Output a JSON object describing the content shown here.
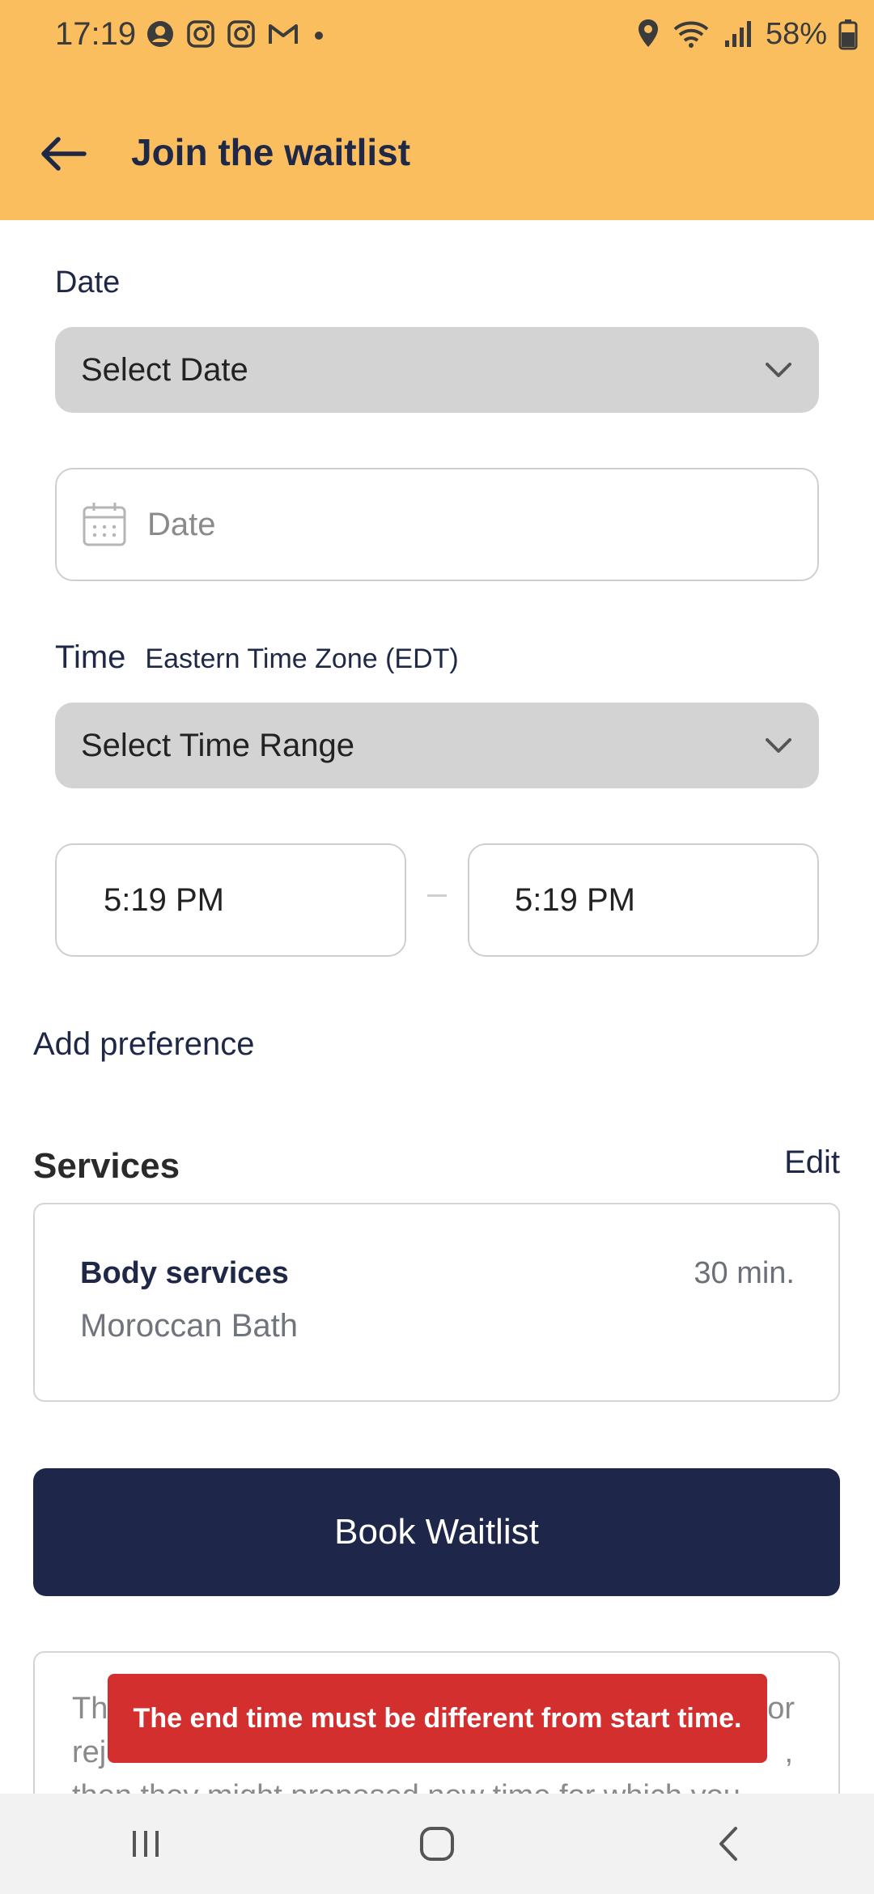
{
  "status_bar": {
    "time": "17:19",
    "battery": "58%",
    "notification_icons": [
      "account-circle-icon",
      "instagram-icon",
      "instagram-icon",
      "gmail-icon",
      "dot-icon"
    ],
    "system_icons": [
      "location-icon",
      "wifi-icon",
      "signal-icon",
      "battery-icon"
    ]
  },
  "header": {
    "title": "Join the waitlist",
    "background": "#fbbe5f"
  },
  "date_section": {
    "label": "Date",
    "select_value": "Select Date",
    "date_placeholder": "Date"
  },
  "time_section": {
    "label": "Time",
    "timezone": "Eastern Time Zone (EDT)",
    "select_value": "Select Time Range",
    "start_time": "5:19 PM",
    "end_time": "5:19 PM"
  },
  "add_preference": "Add preference",
  "services": {
    "title": "Services",
    "edit_label": "Edit",
    "item": {
      "category": "Body services",
      "duration": "30 min.",
      "name": "Moroccan Bath"
    }
  },
  "book_button": {
    "label": "Book Waitlist",
    "color": "#1e2749"
  },
  "info_card": {
    "line1_start": "Th",
    "line1_end": "or",
    "line2_start": "rej",
    "line2_end": ",",
    "line3": "then they might proposed new time for which you"
  },
  "toast": {
    "message": "The end time must be different from start time.",
    "color": "#d32f2f"
  },
  "nav_bar": {
    "buttons": [
      "recent-apps-icon",
      "home-icon",
      "back-icon"
    ]
  }
}
